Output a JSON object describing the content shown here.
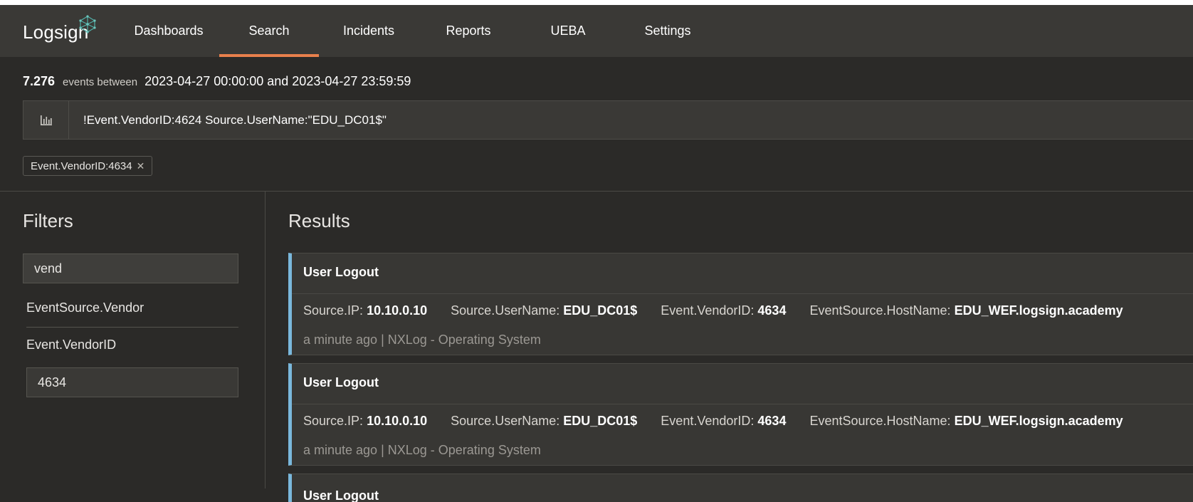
{
  "app": {
    "logo_text": "Logsign"
  },
  "nav": {
    "items": [
      {
        "label": "Dashboards"
      },
      {
        "label": "Search",
        "active": true
      },
      {
        "label": "Incidents"
      },
      {
        "label": "Reports"
      },
      {
        "label": "UEBA"
      },
      {
        "label": "Settings"
      }
    ]
  },
  "summary": {
    "count": "7.276",
    "between_label": "events between",
    "range": "2023-04-27 00:00:00 and 2023-04-27 23:59:59"
  },
  "query": {
    "icon": "bar-chart-icon",
    "text": "!Event.VendorID:4624 Source.UserName:\"EDU_DC01$\""
  },
  "active_filters": [
    {
      "label": "Event.VendorID:4634"
    }
  ],
  "filters": {
    "title": "Filters",
    "search_value": "vend",
    "fields": [
      "EventSource.Vendor",
      "Event.VendorID"
    ],
    "selected_value": "4634"
  },
  "results": {
    "title": "Results",
    "items": [
      {
        "title": "User Logout",
        "fields": [
          {
            "key": "Source.IP:",
            "value": "10.10.0.10"
          },
          {
            "key": "Source.UserName:",
            "value": "EDU_DC01$"
          },
          {
            "key": "Event.VendorID:",
            "value": "4634"
          },
          {
            "key": "EventSource.HostName:",
            "value": "EDU_WEF.logsign.academy"
          }
        ],
        "meta": "a minute ago | NXLog - Operating System"
      },
      {
        "title": "User Logout",
        "fields": [
          {
            "key": "Source.IP:",
            "value": "10.10.0.10"
          },
          {
            "key": "Source.UserName:",
            "value": "EDU_DC01$"
          },
          {
            "key": "Event.VendorID:",
            "value": "4634"
          },
          {
            "key": "EventSource.HostName:",
            "value": "EDU_WEF.logsign.academy"
          }
        ],
        "meta": "a minute ago | NXLog - Operating System"
      },
      {
        "title": "User Logout"
      }
    ]
  },
  "colors": {
    "accent": "#e8804c",
    "card_border": "#7ab8dc",
    "background": "#2b2a28",
    "navbar": "#3a3936"
  }
}
